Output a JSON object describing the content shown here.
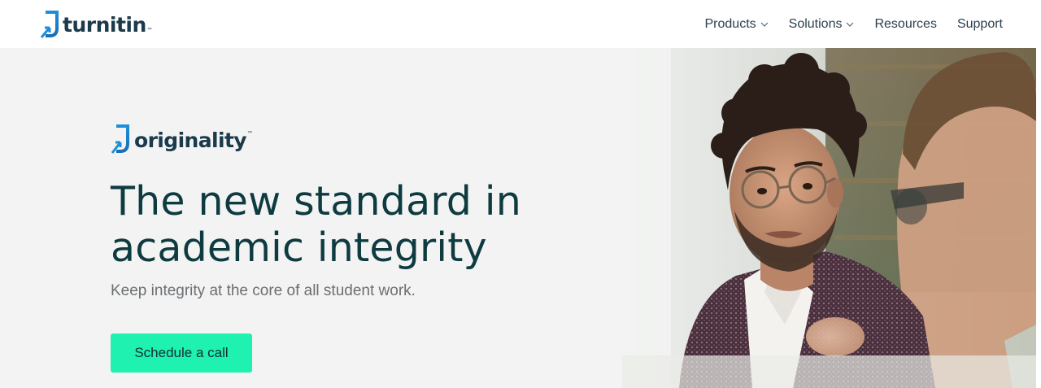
{
  "header": {
    "logo": {
      "icon": "turnitin-logo-mark",
      "text": "turnitin",
      "trademark": "™"
    },
    "nav": [
      {
        "label": "Products",
        "has_dropdown": true
      },
      {
        "label": "Solutions",
        "has_dropdown": true
      },
      {
        "label": "Resources",
        "has_dropdown": false
      },
      {
        "label": "Support",
        "has_dropdown": false
      }
    ]
  },
  "hero": {
    "brand": {
      "icon": "turnitin-logo-mark",
      "text": "originality",
      "trademark": "™"
    },
    "headline_line1": "The new standard in",
    "headline_line2": "academic integrity",
    "subheadline": "Keep integrity at the core of all student work.",
    "cta_label": "Schedule a call"
  },
  "colors": {
    "brand_blue": "#1b8ad6",
    "brand_dark": "#1b3a4b",
    "headline": "#0e3b40",
    "cta_bg": "#1ef1b0",
    "hero_bg": "#f3f3f3"
  }
}
